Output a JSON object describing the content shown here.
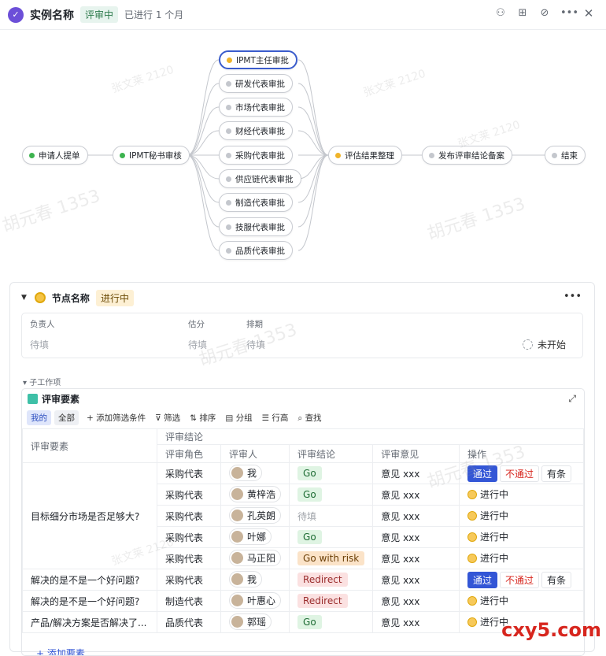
{
  "header": {
    "title": "实例名称",
    "status": "评审中",
    "subtitle": "已进行 1 个月"
  },
  "flow": {
    "start": "申请人提单",
    "secretary": "IPMT秘书审核",
    "approvers": [
      "IPMT主任审批",
      "研发代表审批",
      "市场代表审批",
      "财经代表审批",
      "采购代表审批",
      "供应链代表审批",
      "制造代表审批",
      "技服代表审批",
      "品质代表审批"
    ],
    "summary": "评估结果整理",
    "publish": "发布评审结论备案",
    "end": "结束"
  },
  "node_panel": {
    "name": "节点名称",
    "status": "进行中",
    "fields": {
      "owner_label": "负责人",
      "owner_value": "待填",
      "score_label": "估分",
      "score_value": "待填",
      "schedule_label": "排期",
      "schedule_value": "待填",
      "progress": "未开始"
    },
    "subtasks_label": "子工作项"
  },
  "table_view": {
    "title": "评审要素",
    "toolbar": {
      "mine": "我的",
      "all": "全部",
      "add_filter": "+ 添加筛选条件",
      "filter": "筛选",
      "sort": "排序",
      "group": "分组",
      "row_height": "行高",
      "find": "查找"
    },
    "group_header": "评审结论",
    "columns": [
      "评审要素",
      "评审角色",
      "评审人",
      "评审结论",
      "评审意见",
      "操作"
    ],
    "element_main": "目标细分市场是否足够大?",
    "rows": [
      {
        "role": "采购代表",
        "reviewer": "我",
        "conclusion": "Go",
        "opinion": "意见 xxx"
      },
      {
        "role": "采购代表",
        "reviewer": "黄梓浩",
        "conclusion": "Go",
        "opinion": "意见 xxx"
      },
      {
        "role": "采购代表",
        "reviewer": "孔英朗",
        "conclusion": "待填",
        "opinion": "意见 xxx"
      },
      {
        "role": "采购代表",
        "reviewer": "叶娜",
        "conclusion": "Go",
        "opinion": "意见 xxx"
      },
      {
        "role": "采购代表",
        "reviewer": "马正阳",
        "conclusion": "Go with risk",
        "opinion": "意见 xxx"
      },
      {
        "element": "解决的是不是一个好问题?",
        "role": "采购代表",
        "reviewer": "我",
        "conclusion": "Redirect",
        "opinion": "意见 xxx"
      },
      {
        "element": "解决的是不是一个好问题?",
        "role": "制造代表",
        "reviewer": "叶惠心",
        "conclusion": "Redirect",
        "opinion": "意见 xxx"
      },
      {
        "element": "产品/解决方案是否解决了...",
        "role": "品质代表",
        "reviewer": "郭瑶",
        "conclusion": "Go",
        "opinion": "意见 xxx"
      }
    ],
    "actions": {
      "pass": "通过",
      "reject": "不通过",
      "conditional": "有条",
      "in_progress": "进行中"
    },
    "add_element": "添加要素"
  },
  "watermarks": {
    "a": "张文莱 2120",
    "b": "胡元春 1353"
  },
  "brand": "cxy5.com"
}
